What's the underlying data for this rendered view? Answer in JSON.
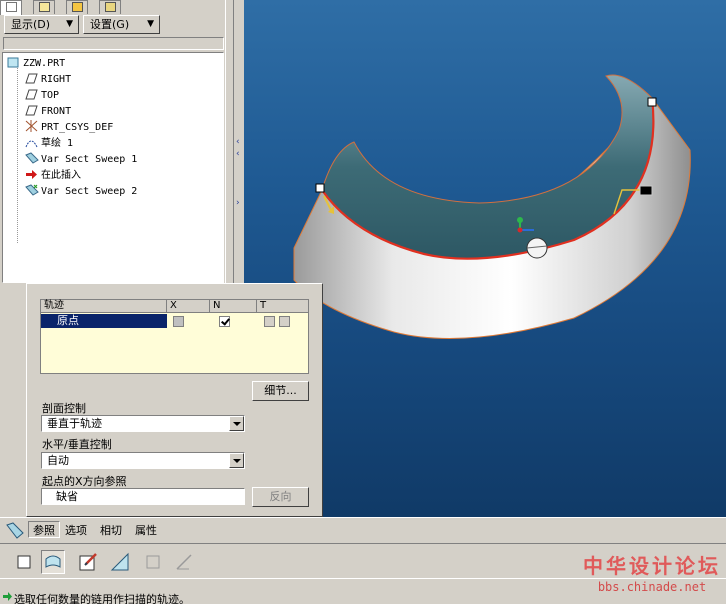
{
  "menus": {
    "display": "显示(D)",
    "settings": "设置(G)",
    "arrow_icon": "triangle-down"
  },
  "tree": {
    "items": [
      {
        "label": "ZZW.PRT",
        "icon": "part-icon"
      },
      {
        "label": "RIGHT",
        "icon": "datum-plane-icon"
      },
      {
        "label": "TOP",
        "icon": "datum-plane-icon"
      },
      {
        "label": "FRONT",
        "icon": "datum-plane-icon"
      },
      {
        "label": "PRT_CSYS_DEF",
        "icon": "coordinate-system-icon"
      },
      {
        "label": "草绘 1",
        "icon": "sketch-icon"
      },
      {
        "label": "Var Sect Sweep 1",
        "icon": "sweep-icon"
      },
      {
        "label": "在此插入",
        "icon": "insert-arrow-icon"
      },
      {
        "label": "Var Sect Sweep 2",
        "icon": "sweep-icon"
      }
    ]
  },
  "references": {
    "table": {
      "headers": [
        "轨迹",
        "X",
        "N",
        "T"
      ],
      "rows": [
        {
          "name": "原点",
          "x": "disabled",
          "n": true,
          "t": "boxes"
        }
      ]
    },
    "details_button": "细节...",
    "section_control_label": "剖面控制",
    "section_control_value": "垂直于轨迹",
    "hv_control_label": "水平/垂直控制",
    "hv_control_value": "自动",
    "x_ref_label": "起点的X方向参照",
    "x_ref_value": "缺省",
    "flip_button": "反向"
  },
  "dashboard_tabs": [
    "参照",
    "选项",
    "相切",
    "属性"
  ],
  "toolbar_icons": [
    "solid-icon",
    "surface-icon",
    "sketch-edit-icon",
    "remove-material-icon",
    "thicken-icon",
    "disabled-icon"
  ],
  "status": {
    "message": "选取任何数量的链用作扫描的轨迹。"
  },
  "watermark": {
    "title": "中华设计论坛",
    "url": "bbs.chinade.net"
  },
  "colors": {
    "viewport_bg": "#1f5a93",
    "selection": "#0a246a",
    "trajectory": "#e03020"
  }
}
